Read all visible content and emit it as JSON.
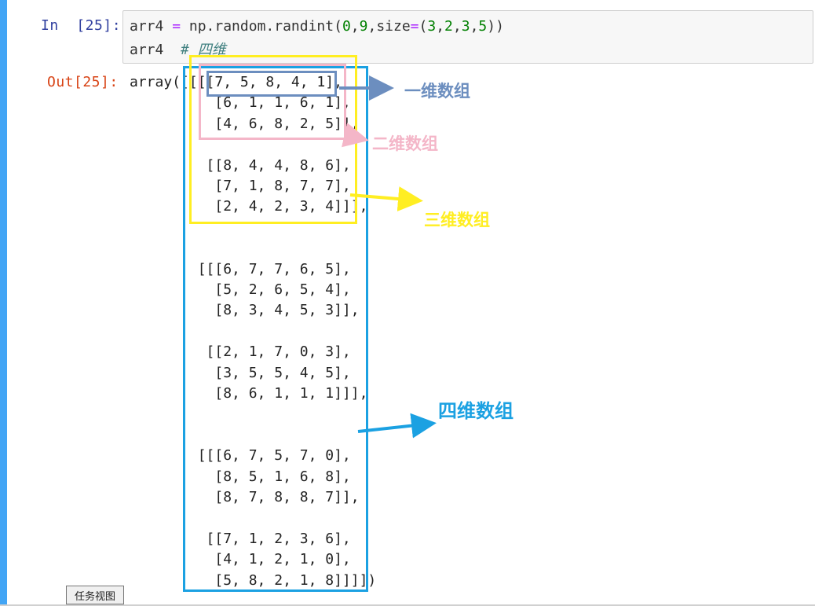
{
  "cell": {
    "in_prompt": "In  [25]:",
    "out_prompt": "Out[25]:",
    "code_line1": {
      "a": "arr4",
      "eq": " = ",
      "b": "np.random.randint(",
      "n1": "0",
      "c1": ",",
      "n2": "9",
      "c2": ",size",
      "eq2": "=",
      "p1": "(",
      "n3": "3",
      "c3": ",",
      "n4": "2",
      "c4": ",",
      "n5": "3",
      "c5": ",",
      "n6": "5",
      "p2": "))"
    },
    "code_line2": {
      "var": "arr4",
      "comment": "# 四维"
    }
  },
  "output": {
    "lines": [
      "array([[[[7, 5, 8, 4, 1],",
      "          [6, 1, 1, 6, 1],",
      "          [4, 6, 8, 2, 5]],",
      "",
      "         [[8, 4, 4, 8, 6],",
      "          [7, 1, 8, 7, 7],",
      "          [2, 4, 2, 3, 4]]],",
      "",
      "",
      "        [[[6, 7, 7, 6, 5],",
      "          [5, 2, 6, 5, 4],",
      "          [8, 3, 4, 5, 3]],",
      "",
      "         [[2, 1, 7, 0, 3],",
      "          [3, 5, 5, 4, 5],",
      "          [8, 6, 1, 1, 1]]],",
      "",
      "",
      "        [[[6, 7, 5, 7, 0],",
      "          [8, 5, 1, 6, 8],",
      "          [8, 7, 8, 8, 7]],",
      "",
      "         [[7, 1, 2, 3, 6],",
      "          [4, 1, 2, 1, 0],",
      "          [5, 8, 2, 1, 8]]]])"
    ]
  },
  "annotations": {
    "one_d": "一维数组",
    "two_d": "二维数组",
    "three_d": "三维数组",
    "four_d": "四维数组"
  },
  "colors": {
    "one_d": "#6c8ebf",
    "two_d": "#f4b6c8",
    "three_d": "#ffee22",
    "four_d": "#1ba1e2"
  },
  "taskbar_tooltip": "任务视图"
}
